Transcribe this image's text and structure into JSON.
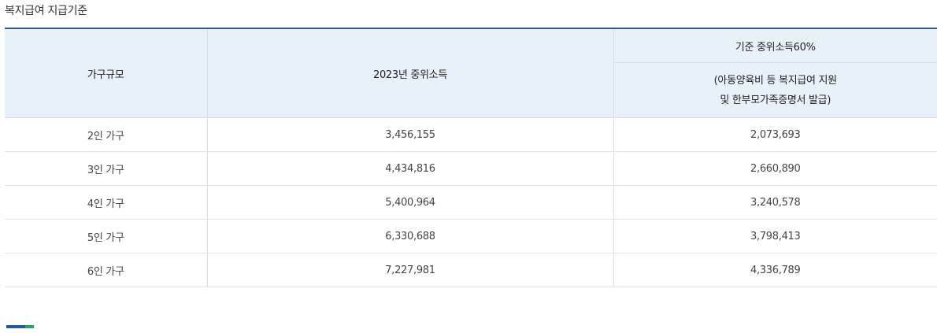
{
  "section": {
    "title": "복지급여 지급기준"
  },
  "table": {
    "headers": {
      "household_size": "가구규모",
      "median_income": "2023년 중위소득",
      "criteria_60": "기준 중위소득60%",
      "criteria_note_line1": "(아동양육비 등 복지급여 지원",
      "criteria_note_line2": "및 한부모가족증명서 발급)"
    },
    "rows": [
      {
        "size": "2인 가구",
        "median": "3,456,155",
        "criteria": "2,073,693"
      },
      {
        "size": "3인 가구",
        "median": "4,434,816",
        "criteria": "2,660,890"
      },
      {
        "size": "4인 가구",
        "median": "5,400,964",
        "criteria": "3,240,578"
      },
      {
        "size": "5인 가구",
        "median": "6,330,688",
        "criteria": "3,798,413"
      },
      {
        "size": "6인 가구",
        "median": "7,227,981",
        "criteria": "4,336,789"
      }
    ]
  },
  "colors": {
    "header_bg": "#e8f1fa",
    "top_border": "#2a5c8f",
    "accent_blue": "#1f5aa6",
    "accent_green": "#27a35a"
  }
}
